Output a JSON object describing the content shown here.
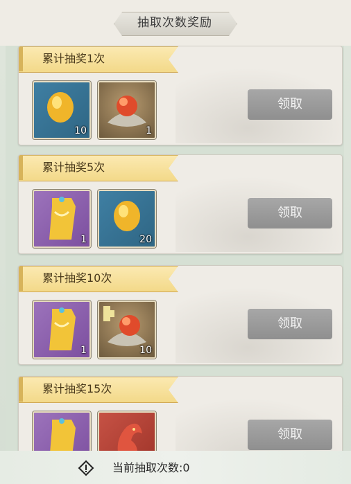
{
  "header": {
    "title": "抽取次数奖励"
  },
  "rewards": [
    {
      "label": "累计抽奖1次",
      "items": [
        {
          "icon": "gold-egg-icon",
          "qty": "10"
        },
        {
          "icon": "fire-orb-lotus-icon",
          "qty": "1"
        }
      ],
      "button": "领取"
    },
    {
      "label": "累计抽奖5次",
      "items": [
        {
          "icon": "golden-robe-icon",
          "qty": "1"
        },
        {
          "icon": "gold-egg-icon",
          "qty": "20"
        }
      ],
      "button": "领取"
    },
    {
      "label": "累计抽奖10次",
      "items": [
        {
          "icon": "golden-robe-icon",
          "qty": "1"
        },
        {
          "icon": "fire-orb-lotus-fragment-icon",
          "qty": "10"
        }
      ],
      "button": "领取"
    },
    {
      "label": "累计抽奖15次",
      "items": [
        {
          "icon": "golden-robe-icon",
          "qty": ""
        },
        {
          "icon": "red-dragon-icon",
          "qty": ""
        }
      ],
      "button": "领取"
    }
  ],
  "footer": {
    "text": "当前抽取次数:0"
  }
}
